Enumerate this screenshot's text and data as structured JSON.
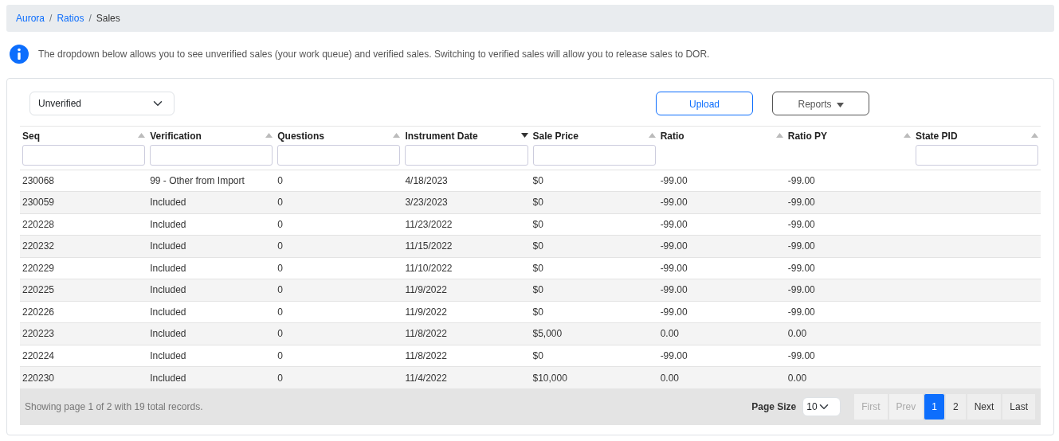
{
  "breadcrumb": [
    {
      "label": "Aurora",
      "link": true,
      "separator": "/"
    },
    {
      "label": "Ratios",
      "link": true,
      "separator": "/"
    },
    {
      "label": "Sales",
      "link": false
    }
  ],
  "info": "The dropdown below allows you to see unverified sales (your work queue) and verified sales. Switching to verified sales will allow you to release sales to DOR.",
  "view_select": {
    "value": "Unverified"
  },
  "buttons": [
    {
      "label": "Upload",
      "kind": "primary"
    },
    {
      "label": "Reports",
      "kind": "dropdown"
    }
  ],
  "table": {
    "columns": [
      {
        "label": "Seq",
        "filterable": true,
        "sorted": false
      },
      {
        "label": "Verification",
        "filterable": true,
        "sorted": false
      },
      {
        "label": "Questions",
        "filterable": true,
        "sorted": false
      },
      {
        "label": "Instrument Date",
        "filterable": true,
        "sorted": true
      },
      {
        "label": "Sale Price",
        "filterable": true,
        "sorted": false
      },
      {
        "label": "Ratio",
        "filterable": false,
        "sorted": false
      },
      {
        "label": "Ratio PY",
        "filterable": false,
        "sorted": false
      },
      {
        "label": "State PID",
        "filterable": true,
        "sorted": false
      }
    ],
    "rows": [
      [
        "230068",
        "99 - Other from Import",
        "0",
        "4/18/2023",
        "$0",
        "-99.00",
        "-99.00"
      ],
      [
        "230059",
        "Included",
        "0",
        "3/23/2023",
        "$0",
        "-99.00",
        "-99.00"
      ],
      [
        "220228",
        "Included",
        "0",
        "11/23/2022",
        "$0",
        "-99.00",
        "-99.00"
      ],
      [
        "220232",
        "Included",
        "0",
        "11/15/2022",
        "$0",
        "-99.00",
        "-99.00"
      ],
      [
        "220229",
        "Included",
        "0",
        "11/10/2022",
        "$0",
        "-99.00",
        "-99.00"
      ],
      [
        "220225",
        "Included",
        "0",
        "11/9/2022",
        "$0",
        "-99.00",
        "-99.00"
      ],
      [
        "220226",
        "Included",
        "0",
        "11/9/2022",
        "$0",
        "-99.00",
        "-99.00"
      ],
      [
        "220223",
        "Included",
        "0",
        "11/8/2022",
        "$5,000",
        "0.00",
        "0.00"
      ],
      [
        "220224",
        "Included",
        "0",
        "11/8/2022",
        "$0",
        "-99.00",
        "-99.00"
      ],
      [
        "220230",
        "Included",
        "0",
        "11/4/2022",
        "$10,000",
        "0.00",
        "0.00"
      ]
    ]
  },
  "footer": {
    "summary": "Showing page 1 of 2 with 19 total records.",
    "page_size_label": "Page Size",
    "page_size": "10",
    "pages": [
      {
        "label": "First",
        "disabled": true,
        "selected": false
      },
      {
        "label": "Prev",
        "disabled": true,
        "selected": false
      },
      {
        "label": "1",
        "disabled": false,
        "selected": true
      },
      {
        "label": "2",
        "disabled": false,
        "selected": false
      },
      {
        "label": "Next",
        "disabled": false,
        "selected": false
      },
      {
        "label": "Last",
        "disabled": false,
        "selected": false
      }
    ]
  }
}
